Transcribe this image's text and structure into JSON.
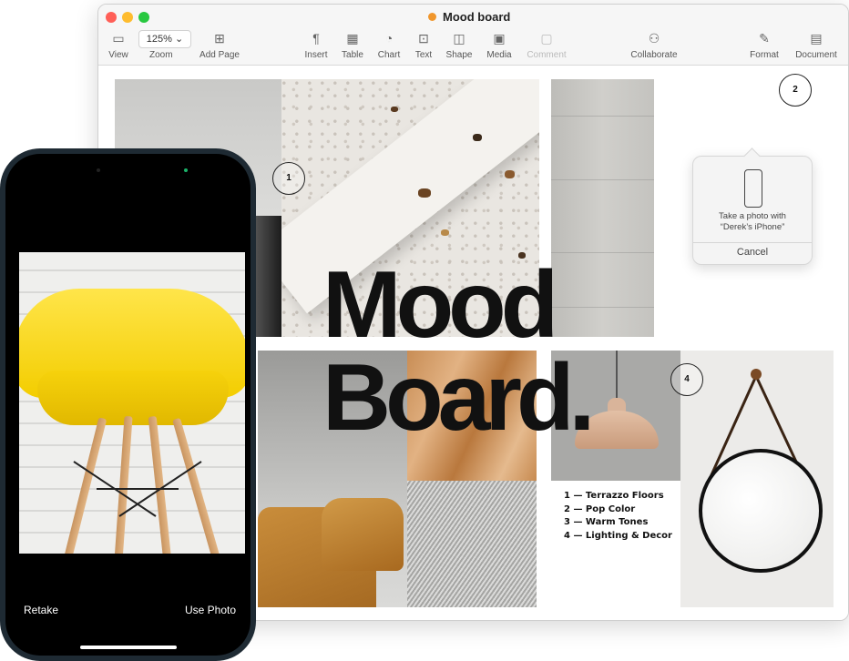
{
  "window": {
    "title": "Mood board",
    "toolbar": {
      "view": "View",
      "zoom_value": "125% ⌄",
      "zoom": "Zoom",
      "add_page": "Add Page",
      "insert": "Insert",
      "table": "Table",
      "chart": "Chart",
      "text": "Text",
      "shape": "Shape",
      "media": "Media",
      "comment": "Comment",
      "collaborate": "Collaborate",
      "format": "Format",
      "document": "Document"
    },
    "colors": {
      "close": "#ff5f57",
      "minimize": "#febc2e",
      "zoom": "#28c840",
      "doc_dot": "#f0962c"
    }
  },
  "document": {
    "heading_line1": "Mood",
    "heading_line2": "Board.",
    "callouts": [
      "1",
      "2",
      "4"
    ],
    "legend": [
      "1 — Terrazzo Floors",
      "2 — Pop Color",
      "3 — Warm Tones",
      "4 — Lighting & Decor"
    ]
  },
  "popover": {
    "message_line1": "Take a photo with",
    "message_line2": "“Derek’s iPhone”",
    "cancel": "Cancel"
  },
  "phone": {
    "retake": "Retake",
    "use_photo": "Use Photo"
  }
}
